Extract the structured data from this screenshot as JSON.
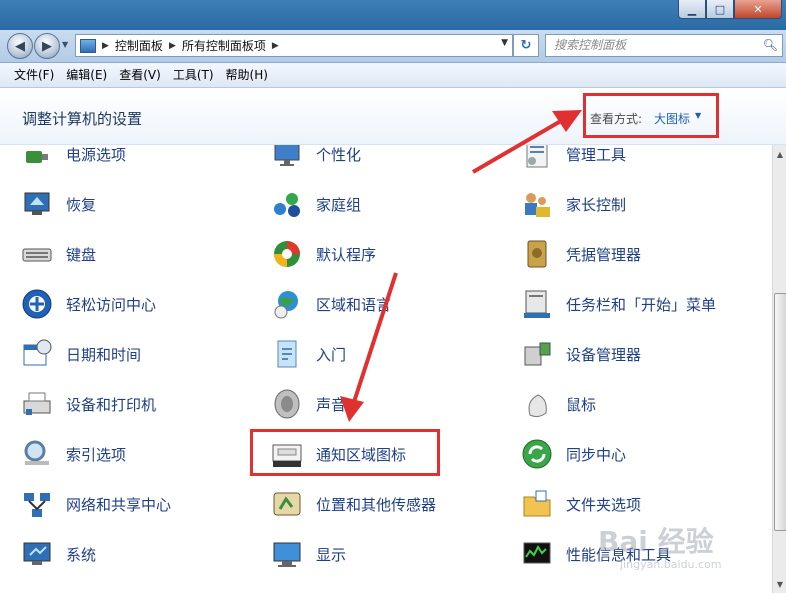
{
  "window": {
    "min_glyph": "▁",
    "max_glyph": "□",
    "close_glyph": "✕"
  },
  "address": {
    "crumbs": [
      "控制面板",
      "所有控制面板项"
    ],
    "separator": "▶"
  },
  "search": {
    "placeholder": "搜索控制面板"
  },
  "menu": [
    "文件(F)",
    "编辑(E)",
    "查看(V)",
    "工具(T)",
    "帮助(H)"
  ],
  "header": {
    "title": "调整计算机的设置",
    "view_by_label": "查看方式:",
    "view_by_value": "大图标"
  },
  "items": [
    {
      "label": "电源选项",
      "icon": "power-options-icon"
    },
    {
      "label": "个性化",
      "icon": "personalization-icon"
    },
    {
      "label": "管理工具",
      "icon": "admin-tools-icon"
    },
    {
      "label": "恢复",
      "icon": "recovery-icon"
    },
    {
      "label": "家庭组",
      "icon": "homegroup-icon"
    },
    {
      "label": "家长控制",
      "icon": "parental-controls-icon"
    },
    {
      "label": "键盘",
      "icon": "keyboard-icon"
    },
    {
      "label": "默认程序",
      "icon": "default-programs-icon"
    },
    {
      "label": "凭据管理器",
      "icon": "credential-manager-icon"
    },
    {
      "label": "轻松访问中心",
      "icon": "ease-of-access-icon"
    },
    {
      "label": "区域和语言",
      "icon": "region-language-icon"
    },
    {
      "label": "任务栏和「开始」菜单",
      "icon": "taskbar-start-menu-icon"
    },
    {
      "label": "日期和时间",
      "icon": "date-time-icon"
    },
    {
      "label": "入门",
      "icon": "getting-started-icon"
    },
    {
      "label": "设备管理器",
      "icon": "device-manager-icon"
    },
    {
      "label": "设备和打印机",
      "icon": "devices-printers-icon"
    },
    {
      "label": "声音",
      "icon": "sound-icon"
    },
    {
      "label": "鼠标",
      "icon": "mouse-icon"
    },
    {
      "label": "索引选项",
      "icon": "indexing-options-icon"
    },
    {
      "label": "通知区域图标",
      "icon": "notification-area-icons-icon"
    },
    {
      "label": "同步中心",
      "icon": "sync-center-icon"
    },
    {
      "label": "网络和共享中心",
      "icon": "network-sharing-icon"
    },
    {
      "label": "位置和其他传感器",
      "icon": "location-sensors-icon"
    },
    {
      "label": "文件夹选项",
      "icon": "folder-options-icon"
    },
    {
      "label": "系统",
      "icon": "system-icon"
    },
    {
      "label": "显示",
      "icon": "display-icon"
    },
    {
      "label": "性能信息和工具",
      "icon": "performance-icon"
    }
  ],
  "watermark": {
    "brand": "Bai 经验",
    "url": "jingyan.baidu.com"
  },
  "colors": {
    "annotation": "#e03030",
    "link": "#1f3f87",
    "view_value": "#1c5fb3"
  }
}
